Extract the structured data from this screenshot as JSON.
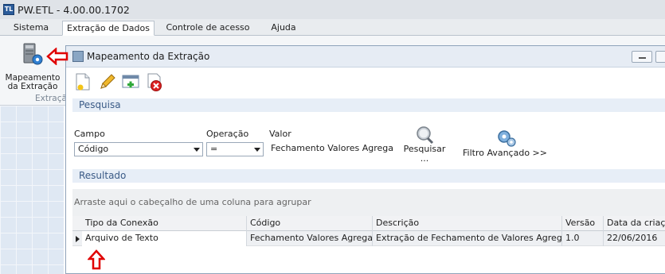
{
  "app": {
    "logo_text": "TL",
    "title": "PW.ETL - 4.00.00.1702"
  },
  "ribbon": {
    "tabs": [
      {
        "label": "Sistema",
        "active": false
      },
      {
        "label": "Extração de Dados",
        "active": true
      },
      {
        "label": "Controle de acesso",
        "active": false
      },
      {
        "label": "Ajuda",
        "active": false
      }
    ],
    "button_label_line1": "Mapeamento",
    "button_label_line2": "da Extração",
    "group_label": "Extraçã"
  },
  "window": {
    "title": "Mapeamento da Extração"
  },
  "search": {
    "section_title": "Pesquisa",
    "campo_label": "Campo",
    "campo_value": "Código",
    "operacao_label": "Operação",
    "operacao_value": "=",
    "valor_label": "Valor",
    "valor_value": "Fechamento Valores Agregados",
    "search_button_label": "Pesquisar",
    "search_button_ellipsis": "...",
    "advanced_filter_label": "Filtro Avançado >>"
  },
  "results": {
    "section_title": "Resultado",
    "group_hint": "Arraste aqui o cabeçalho de uma coluna para agrupar",
    "columns": [
      "Tipo da Conexão",
      "Código",
      "Descrição",
      "Versão",
      "Data da criação"
    ],
    "rows": [
      [
        "Arquivo de Texto",
        "Fechamento Valores Agregados",
        "Extração de Fechamento de  Valores Agregados",
        "1.0",
        "22/06/2016"
      ]
    ]
  },
  "colors": {
    "accent_red": "#e00000",
    "section_header_bg": "#e7eef7",
    "section_header_text": "#3a5a86"
  }
}
